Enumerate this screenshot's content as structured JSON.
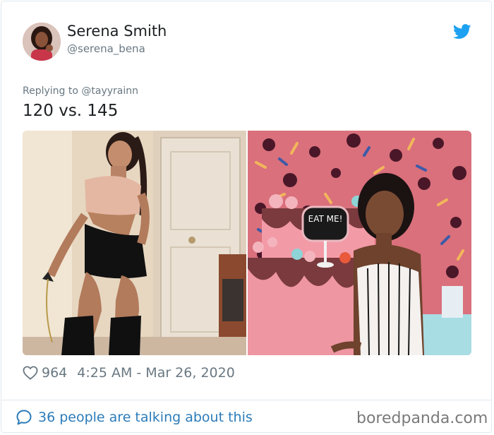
{
  "user": {
    "display_name": "Serena Smith",
    "handle": "@serena_bena"
  },
  "tweet": {
    "replying_to": "Replying to @tayyrainn",
    "text": "120 vs. 145",
    "like_count": "964",
    "timestamp": "4:25 AM - Mar 26, 2020"
  },
  "footer": {
    "conversation": "36 people are talking about this",
    "watermark": "boredpanda.com"
  },
  "icons": {
    "brand": "twitter-bird-icon",
    "like": "heart-icon",
    "reply": "speech-bubble-icon"
  },
  "images": {
    "left_sign": "",
    "right_sign": "EAT ME!"
  },
  "colors": {
    "twitter_blue": "#1da1f2",
    "link_blue": "#2b7bb9",
    "muted_gray": "#697882",
    "text_dark": "#1c2022",
    "border": "#e1e8ed"
  }
}
